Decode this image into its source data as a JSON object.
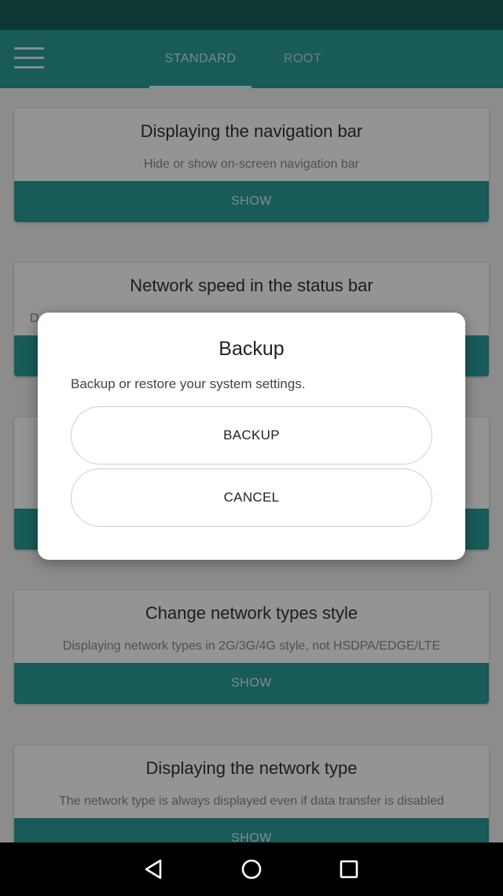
{
  "app_bar": {
    "tabs": [
      {
        "label": "STANDARD",
        "selected": true
      },
      {
        "label": "ROOT",
        "selected": false
      }
    ]
  },
  "cards": [
    {
      "title": "Displaying the navigation bar",
      "description": "Hide or show on-screen navigation bar",
      "button": "SHOW"
    },
    {
      "title": "Network speed in the status bar",
      "description": "D                                                                                                  s",
      "button": ""
    },
    {
      "title": "",
      "description": "",
      "button": ""
    },
    {
      "title": "Change network types style",
      "description": "Displaying network types in 2G/3G/4G style, not HSDPA/EDGE/LTE",
      "button": "SHOW"
    },
    {
      "title": "Displaying the network type",
      "description": "The network type is always displayed even if data transfer is disabled",
      "button": "SHOW"
    }
  ],
  "dialog": {
    "title": "Backup",
    "message": "Backup or restore your system settings.",
    "backup_label": "BACKUP",
    "cancel_label": "CANCEL"
  },
  "icons": {
    "menu": "menu-icon",
    "back": "back-icon",
    "home": "home-icon",
    "recent": "recent-apps-icon"
  },
  "colors": {
    "primary": "#2a9d98",
    "status_bar": "#1a5f5b",
    "dialog_bg": "#ffffff",
    "nav_bar": "#000000"
  }
}
